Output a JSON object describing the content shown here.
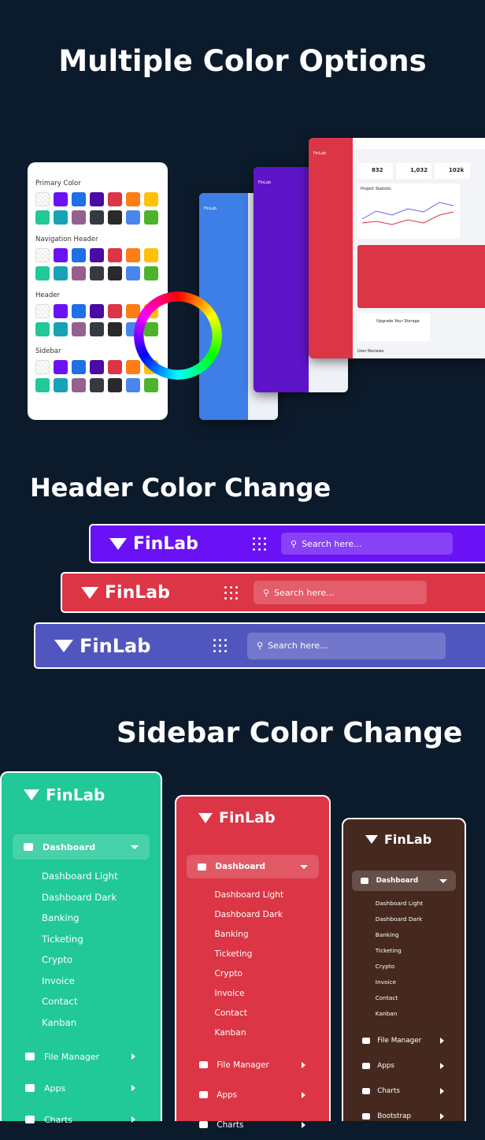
{
  "titles": {
    "colors": "Multiple Color Options",
    "header": "Header Color Change",
    "sidebar": "Sidebar Color Change"
  },
  "panel": {
    "groups": [
      "Primary Color",
      "Navigation Header",
      "Header",
      "Sidebar"
    ],
    "swatches": [
      "none",
      "#6a12f5",
      "#1f6fe5",
      "#4a0aa6",
      "#dc3545",
      "#fd7e14",
      "#ffc107",
      "#20c997",
      "#17a2b8",
      "#94618e",
      "#343a40",
      "#2a2a2a",
      "#4885ed",
      "#4cb32b"
    ]
  },
  "brand": "FinLab",
  "previews": {
    "blue": "#3d7fe6",
    "purple": "#5e14c8",
    "red": "#dc3545",
    "stats": [
      "832",
      "1,032",
      "102k"
    ],
    "chart_title": "Project Statistic",
    "storage": "Upgrade Your Storage",
    "reviews": "User Reviews"
  },
  "headers": [
    {
      "color": "#6a12f5",
      "search": "Search here..."
    },
    {
      "color": "#dc3545",
      "search": "Search here..."
    },
    {
      "color": "#5156be",
      "search": "Search here..."
    }
  ],
  "sidebars": [
    {
      "color": "#20c997",
      "active": "Dashboard",
      "sub": [
        "Dashboard Light",
        "Dashboard Dark",
        "Banking",
        "Ticketing",
        "Crypto",
        "Invoice",
        "Contact",
        "Kanban"
      ],
      "items": [
        "File Manager",
        "Apps",
        "Charts"
      ]
    },
    {
      "color": "#dc3545",
      "active": "Dashboard",
      "sub": [
        "Dashboard Light",
        "Dashboard Dark",
        "Banking",
        "Ticketing",
        "Crypto",
        "Invoice",
        "Contact",
        "Kanban"
      ],
      "items": [
        "File Manager",
        "Apps",
        "Charts"
      ]
    },
    {
      "color": "#45291f",
      "active": "Dashboard",
      "sub": [
        "Dashboard Light",
        "Dashboard Dark",
        "Banking",
        "Ticketing",
        "Crypto",
        "Invoice",
        "Contact",
        "Kanban"
      ],
      "items": [
        "File Manager",
        "Apps",
        "Charts",
        "Bootstrap"
      ]
    }
  ]
}
